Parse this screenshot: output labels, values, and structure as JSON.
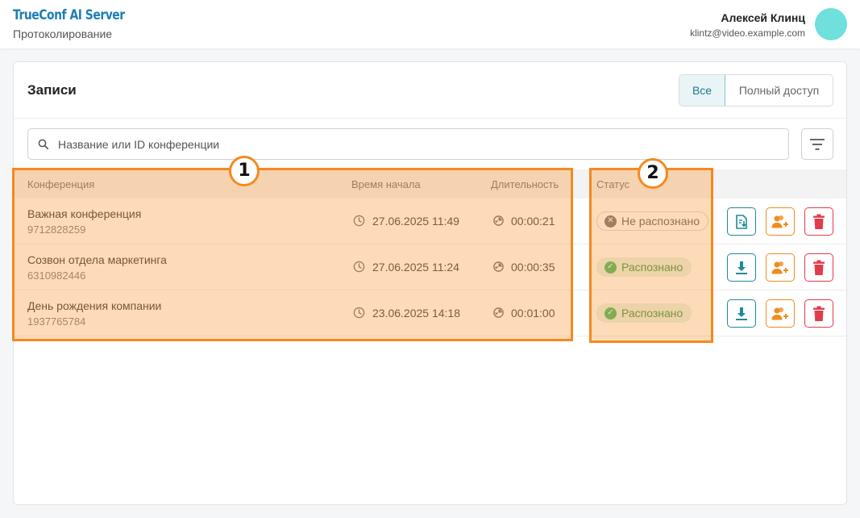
{
  "header": {
    "logo": "TrueConf AI Server",
    "subtitle": "Протоколирование",
    "user_name": "Алексей Клинц",
    "user_email": "klintz@video.example.com"
  },
  "records": {
    "title": "Записи",
    "filter_tabs": [
      {
        "label": "Все",
        "active": true
      },
      {
        "label": "Полный доступ",
        "active": false
      }
    ],
    "search_placeholder": "Название или ID конференции",
    "columns": {
      "conference": "Конференция",
      "start_time": "Время начала",
      "duration": "Длительность",
      "status": "Статус"
    },
    "rows": [
      {
        "name": "Важная конференция",
        "id": "9712828259",
        "start": "27.06.2025 11:49",
        "duration": "00:00:21",
        "status": "Не распознано",
        "status_kind": "neutral"
      },
      {
        "name": "Созвон отдела маркетинга",
        "id": "6310982446",
        "start": "27.06.2025 11:24",
        "duration": "00:00:35",
        "status": "Распознано",
        "status_kind": "ok"
      },
      {
        "name": "День рождения компании",
        "id": "1937765784",
        "start": "23.06.2025 14:18",
        "duration": "00:01:00",
        "status": "Распознано",
        "status_kind": "ok"
      }
    ]
  },
  "annotations": [
    "1",
    "2"
  ],
  "colors": {
    "accent_teal": "#1d8a9a",
    "accent_orange": "#f08c1e",
    "danger_red": "#e23b4b",
    "success_green": "#3bb35a",
    "highlight_orange": "#f5891f"
  },
  "icons": [
    "search-icon",
    "filter-icon",
    "clock-icon",
    "duration-icon",
    "transcript-download-icon",
    "download-icon",
    "add-user-icon",
    "trash-icon",
    "cross-icon",
    "check-icon"
  ]
}
